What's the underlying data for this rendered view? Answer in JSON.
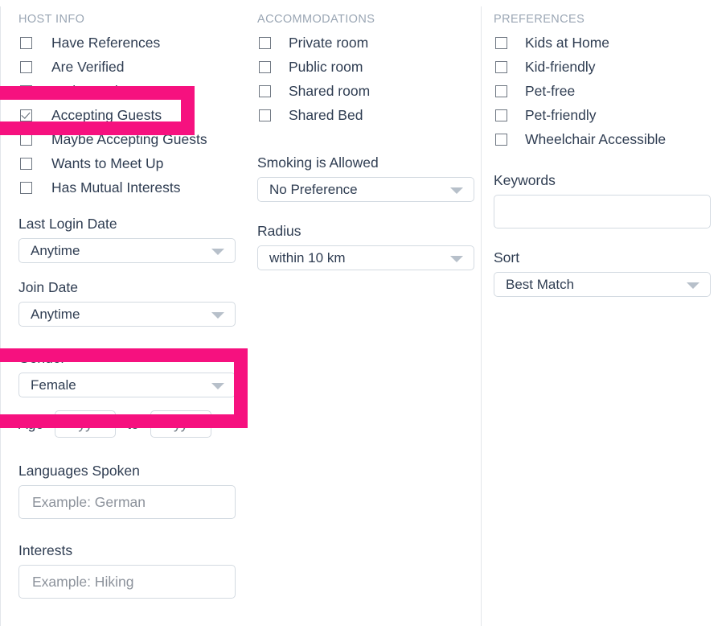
{
  "accent_color": "#f6117f",
  "text_color": "#2f3d52",
  "header_color": "#9aa6b4",
  "border_color": "#d3dae1",
  "columns": {
    "host_info": {
      "heading": "HOST INFO",
      "checkboxes": [
        {
          "label": "Have References",
          "checked": false
        },
        {
          "label": "Are Verified",
          "checked": false
        },
        {
          "label": "Ambassador",
          "checked": false
        },
        {
          "label": "Accepting Guests",
          "checked": true
        },
        {
          "label": "Maybe Accepting Guests",
          "checked": false
        },
        {
          "label": "Wants to Meet Up",
          "checked": false
        },
        {
          "label": "Has Mutual Interests",
          "checked": false
        }
      ],
      "last_login": {
        "label": "Last Login Date",
        "value": "Anytime"
      },
      "join_date": {
        "label": "Join Date",
        "value": "Anytime"
      },
      "gender": {
        "label": "Gender",
        "value": "Female"
      },
      "age": {
        "label": "Age",
        "from_placeholder": "yy",
        "separator": "to",
        "to_placeholder": "yy"
      },
      "languages": {
        "label": "Languages Spoken",
        "placeholder": "Example: German"
      },
      "interests": {
        "label": "Interests",
        "placeholder": "Example: Hiking"
      }
    },
    "accommodations": {
      "heading": "ACCOMMODATIONS",
      "checkboxes": [
        {
          "label": "Private room",
          "checked": false
        },
        {
          "label": "Public room",
          "checked": false
        },
        {
          "label": "Shared room",
          "checked": false
        },
        {
          "label": "Shared Bed",
          "checked": false
        }
      ],
      "smoking": {
        "label": "Smoking is Allowed",
        "value": "No Preference"
      },
      "radius": {
        "label": "Radius",
        "value": "within 10 km"
      }
    },
    "preferences": {
      "heading": "PREFERENCES",
      "checkboxes": [
        {
          "label": "Kids at Home",
          "checked": false
        },
        {
          "label": "Kid-friendly",
          "checked": false
        },
        {
          "label": "Pet-free",
          "checked": false
        },
        {
          "label": "Pet-friendly",
          "checked": false
        },
        {
          "label": "Wheelchair Accessible",
          "checked": false
        }
      ],
      "keywords": {
        "label": "Keywords",
        "value": ""
      },
      "sort": {
        "label": "Sort",
        "value": "Best Match"
      }
    }
  },
  "highlights": [
    {
      "name": "accepting-guests-highlight"
    },
    {
      "name": "gender-highlight"
    }
  ]
}
